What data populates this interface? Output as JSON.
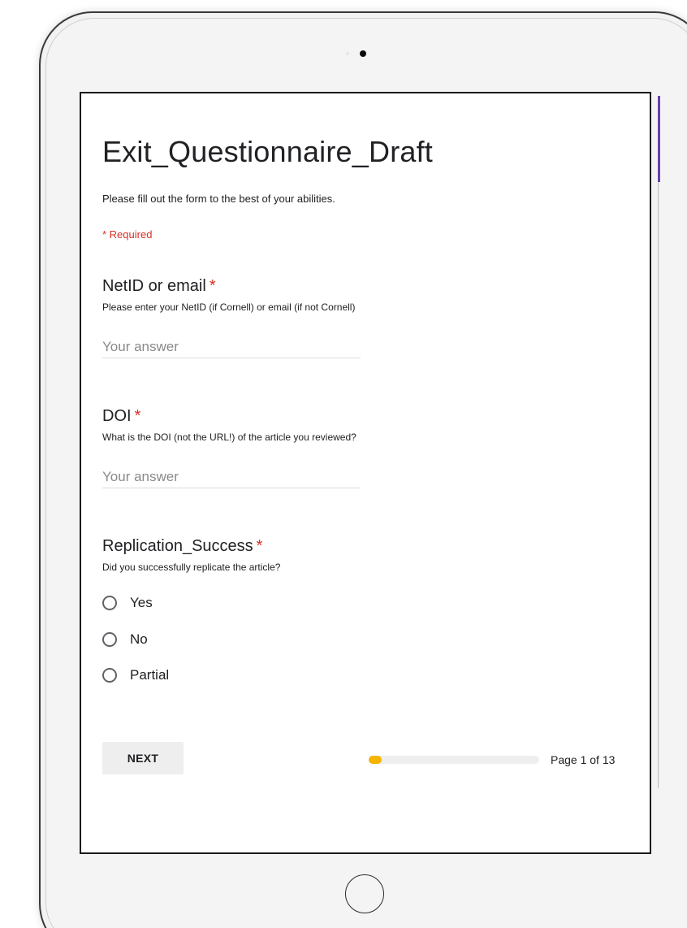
{
  "form": {
    "title": "Exit_Questionnaire_Draft",
    "description": "Please fill out the form to the best of your abilities.",
    "required_note": "* Required"
  },
  "questions": [
    {
      "title": "NetID or email",
      "required_marker": "*",
      "help": "Please enter your NetID (if Cornell) or email (if not Cornell)",
      "answer_placeholder": "Your answer",
      "answer_value": ""
    },
    {
      "title": "DOI",
      "required_marker": "*",
      "help": "What is the DOI (not the URL!) of the article you reviewed?",
      "answer_placeholder": "Your answer",
      "answer_value": ""
    },
    {
      "title": "Replication_Success",
      "required_marker": "*",
      "help": "Did you successfully replicate the article?",
      "options": [
        "Yes",
        "No",
        "Partial"
      ]
    }
  ],
  "footer": {
    "next_label": "NEXT",
    "page_indicator": "Page 1 of 13",
    "progress_fraction": 0.077
  },
  "colors": {
    "accent": "#6a3fb1",
    "required": "#d93025",
    "progress": "#f4b400"
  },
  "icons": {
    "camera": "camera-icon",
    "home_button": "home-button-icon",
    "radio": "radio-unchecked-icon"
  }
}
